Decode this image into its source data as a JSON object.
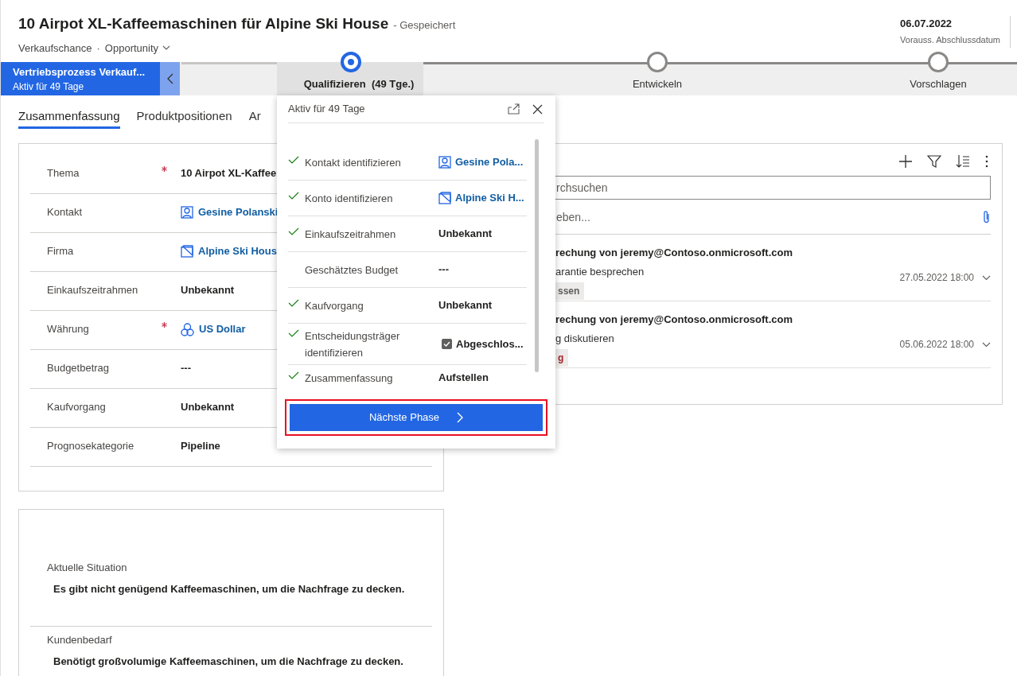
{
  "header": {
    "title": "10 Airpot XL-Kaffeemaschinen für Alpine Ski House",
    "save_state": "- Gespeichert",
    "entity": "Verkaufschance",
    "separator": "·",
    "form": "Opportunity",
    "key_fields": [
      {
        "value": "06.07.2022",
        "label": "Vorauss. Abschlussdatum"
      }
    ]
  },
  "process": {
    "name": "Vertriebsprozess Verkauf...",
    "duration": "Aktiv für 49 Tage",
    "stages": [
      {
        "label": "Qualifizieren  (49 Tge.)",
        "selected": true
      },
      {
        "label": "Entwickeln",
        "selected": false
      },
      {
        "label": "Vorschlagen",
        "selected": false
      }
    ]
  },
  "tabs": [
    {
      "label": "Zusammenfassung",
      "selected": true
    },
    {
      "label": "Produktpositionen",
      "selected": false
    },
    {
      "label": "Ar",
      "selected": false
    }
  ],
  "summary_fields": [
    {
      "label": "Thema",
      "required": true,
      "kind": "text",
      "value": "10 Airpot XL-Kaffee"
    },
    {
      "label": "Kontakt",
      "required": false,
      "kind": "contact",
      "value": "Gesine Polanski"
    },
    {
      "label": "Firma",
      "required": false,
      "kind": "account",
      "value": "Alpine Ski Hous"
    },
    {
      "label": "Einkaufszeitrahmen",
      "required": false,
      "kind": "text",
      "value": "Unbekannt"
    },
    {
      "label": "Währung",
      "required": true,
      "kind": "currency",
      "value": "US Dollar"
    },
    {
      "label": "Budgetbetrag",
      "required": false,
      "kind": "text",
      "value": "---"
    },
    {
      "label": "Kaufvorgang",
      "required": false,
      "kind": "text",
      "value": "Unbekannt"
    },
    {
      "label": "Prognosekategorie",
      "required": false,
      "kind": "text",
      "value": "Pipeline"
    }
  ],
  "details": [
    {
      "label": "Aktuelle Situation",
      "value": "Es gibt nicht genügend Kaffeemaschinen, um die Nachfrage zu decken."
    },
    {
      "label": "Kundenbedarf",
      "value": "Benötigt großvolumige Kaffeemaschinen, um die Nachfrage zu decken."
    }
  ],
  "timeline": {
    "search_placeholder": "rchsuchen",
    "note_placeholder": "eben...",
    "items": [
      {
        "title": "rechung von jeremy@Contoso.onmicrosoft.com",
        "subject": "arantie besprechen",
        "tag": "ssen",
        "color": "#605e5c",
        "time": "27.05.2022 18:00"
      },
      {
        "title": "rechung von jeremy@Contoso.onmicrosoft.com",
        "subject": "g diskutieren",
        "tag": "g",
        "color": "#a4262c",
        "time": "05.06.2022 18:00"
      }
    ]
  },
  "stage_flyout": {
    "title": "Aktiv für 49 Tage",
    "steps": [
      {
        "label": "Kontakt identifizieren",
        "completed": true,
        "kind": "contact",
        "value": "Gesine Pola..."
      },
      {
        "label": "Konto identifizieren",
        "completed": true,
        "kind": "account",
        "value": "Alpine Ski H..."
      },
      {
        "label": "Einkaufszeitrahmen",
        "completed": true,
        "kind": "text",
        "value": "Unbekannt"
      },
      {
        "label": "Geschätztes Budget",
        "completed": false,
        "kind": "text",
        "value": "---"
      },
      {
        "label": "Kaufvorgang",
        "completed": true,
        "kind": "text",
        "value": "Unbekannt"
      },
      {
        "label": "Entscheidungsträger identifizieren",
        "completed": true,
        "kind": "checkbox",
        "checked": true,
        "value": "Abgeschlos..."
      },
      {
        "label": "Zusammenfassung",
        "completed": true,
        "kind": "text",
        "value": "Aufstellen"
      }
    ],
    "button": "Nächste Phase"
  }
}
